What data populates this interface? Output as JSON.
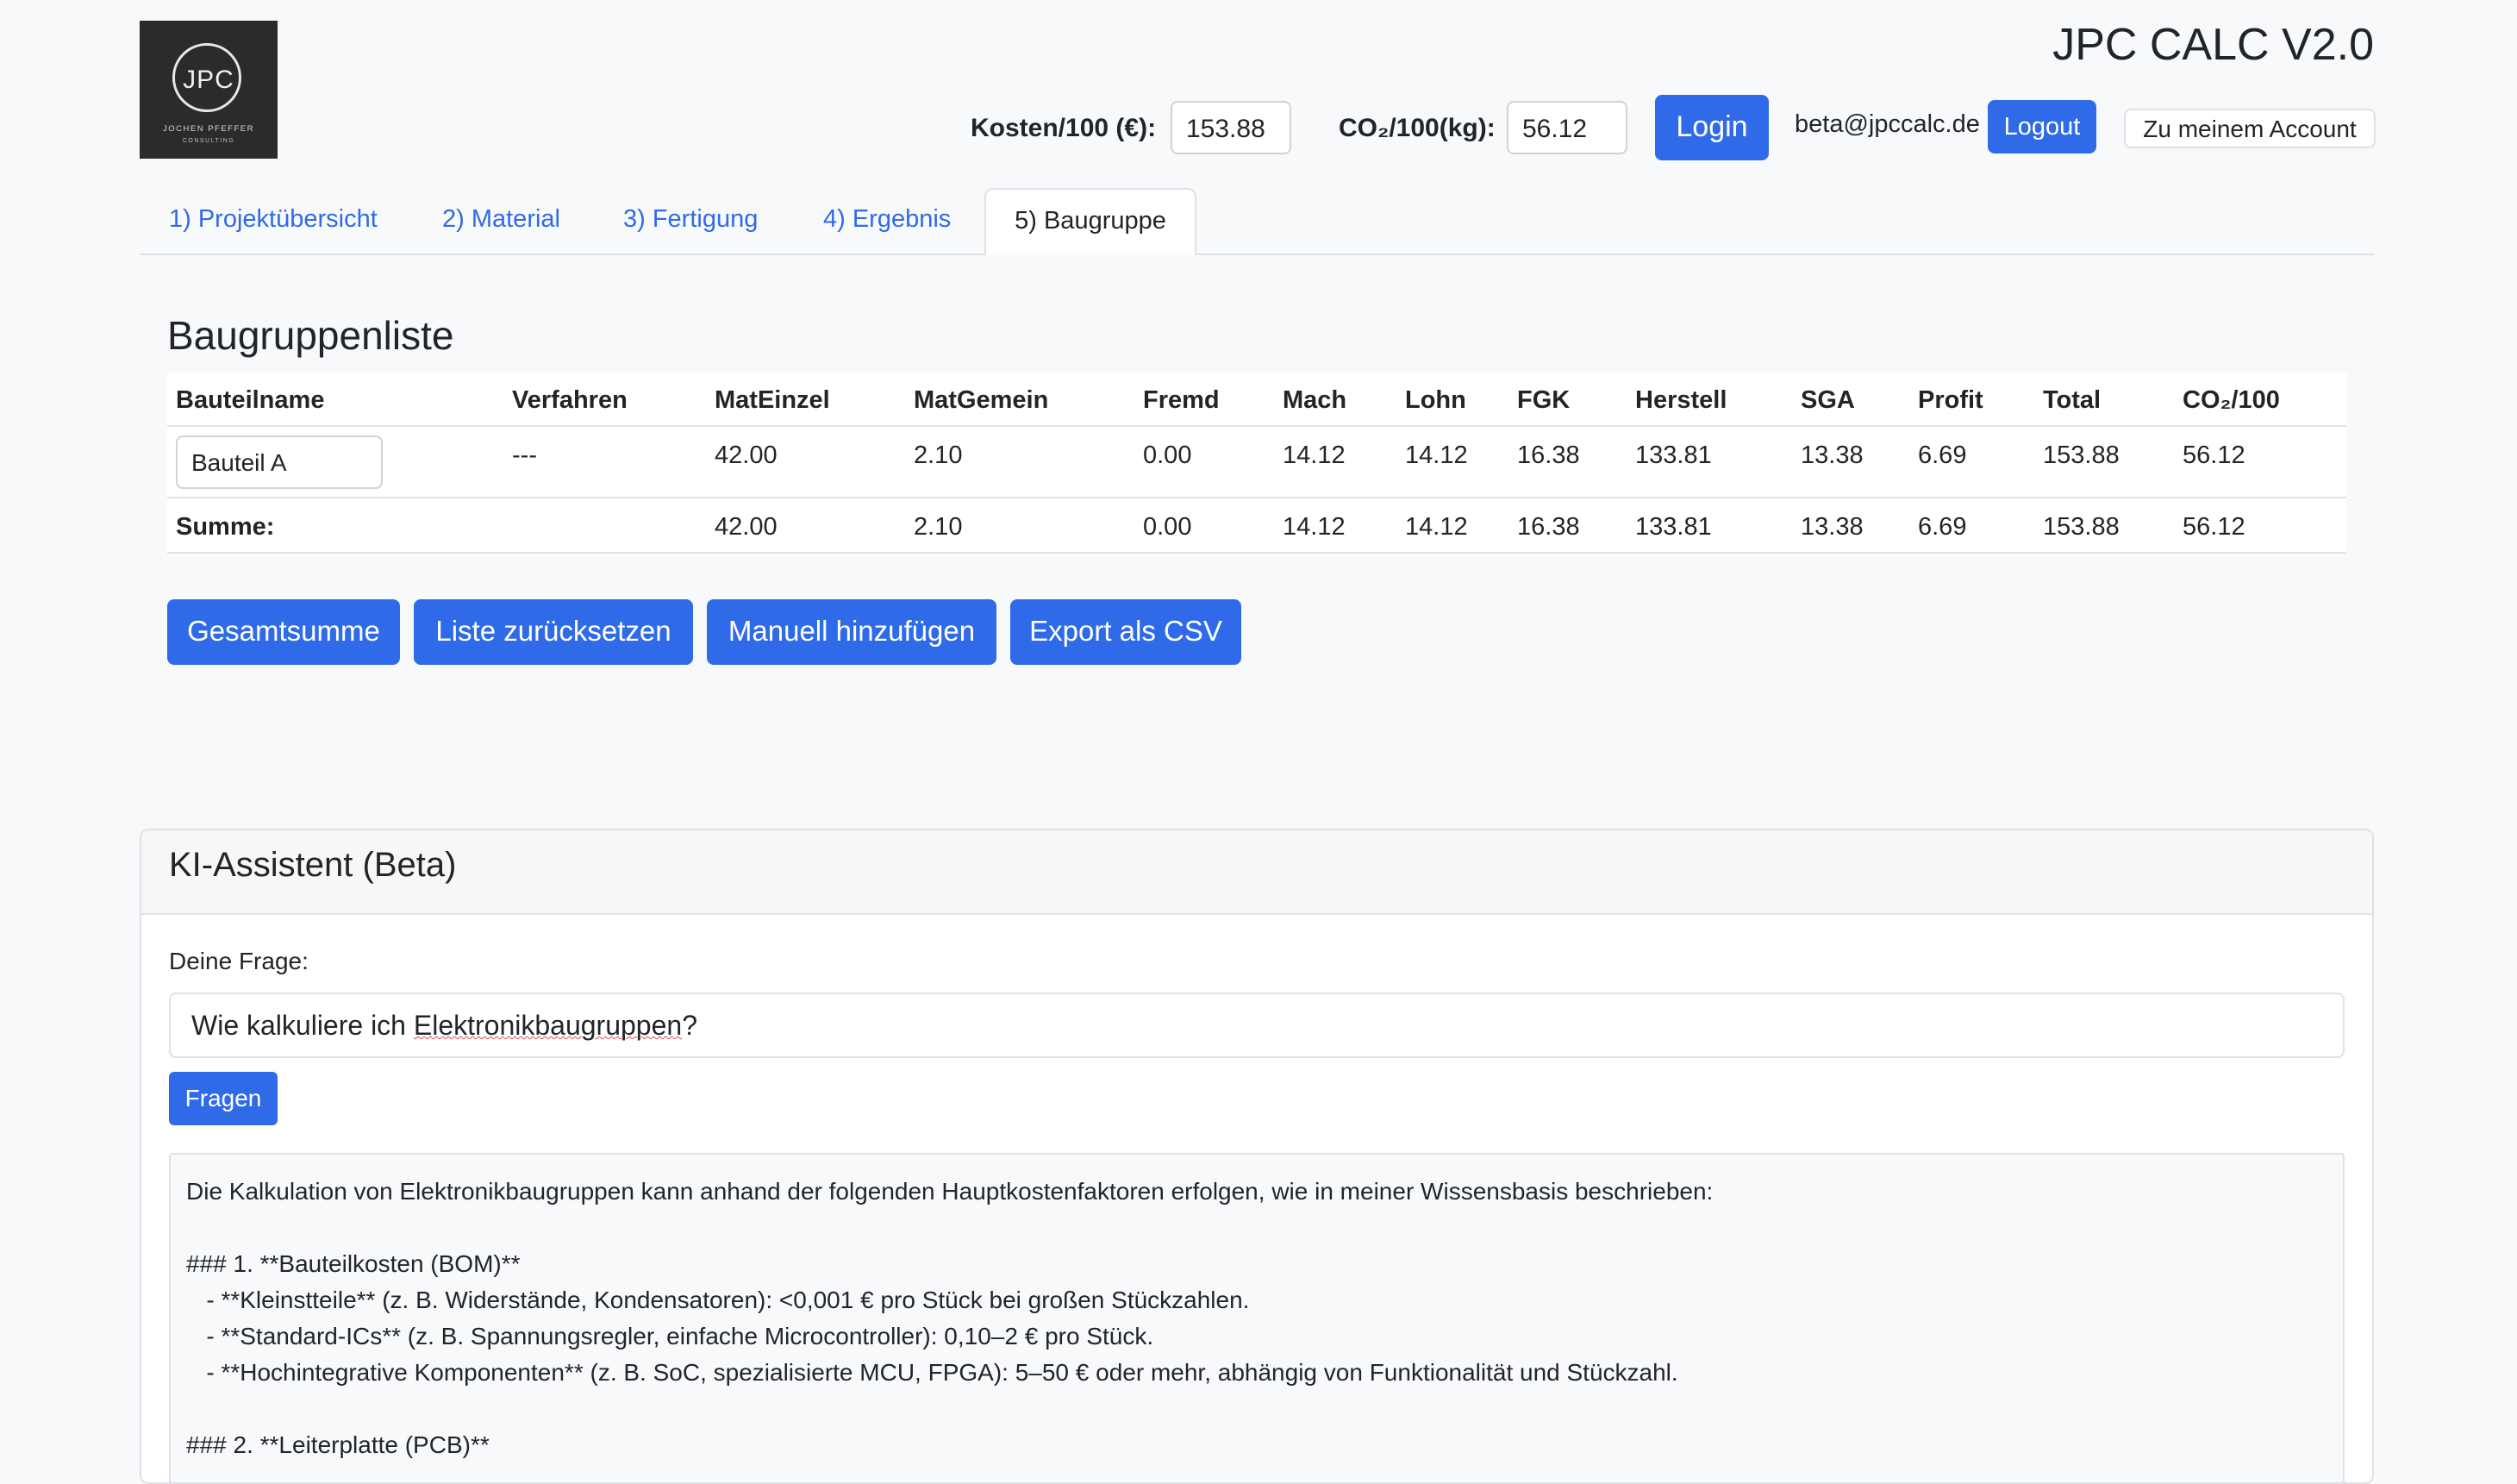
{
  "logo": {
    "mark": "JPC",
    "line1": "JOCHEN PFEFFER",
    "line2": "CONSULTING"
  },
  "header": {
    "app_title": "JPC CALC V2.0",
    "cost_label": "Kosten/100 (€):",
    "cost_value": "153.88",
    "co2_label": "CO₂/100(kg):",
    "co2_value": "56.12",
    "login_label": "Login",
    "user_email": "beta@jpccalc.de",
    "logout_label": "Logout",
    "account_label": "Zu meinem Account"
  },
  "tabs": [
    {
      "label": "1) Projektübersicht"
    },
    {
      "label": "2) Material"
    },
    {
      "label": "3) Fertigung"
    },
    {
      "label": "4) Ergebnis"
    },
    {
      "label": "5) Baugruppe",
      "active": true
    }
  ],
  "list": {
    "title": "Baugruppenliste",
    "columns": [
      "Bauteilname",
      "Verfahren",
      "MatEinzel",
      "MatGemein",
      "Fremd",
      "Mach",
      "Lohn",
      "FGK",
      "Herstell",
      "SGA",
      "Profit",
      "Total",
      "CO₂/100"
    ],
    "rows": [
      {
        "name": "Bauteil A",
        "verfahren": "---",
        "values": [
          "42.00",
          "2.10",
          "0.00",
          "14.12",
          "14.12",
          "16.38",
          "133.81",
          "13.38",
          "6.69",
          "153.88",
          "56.12"
        ]
      }
    ],
    "sum": {
      "label": "Summe:",
      "values": [
        "42.00",
        "2.10",
        "0.00",
        "14.12",
        "14.12",
        "16.38",
        "133.81",
        "13.38",
        "6.69",
        "153.88",
        "56.12"
      ]
    },
    "buttons": {
      "total": "Gesamtsumme",
      "reset": "Liste zurücksetzen",
      "add": "Manuell hinzufügen",
      "export": "Export als CSV"
    }
  },
  "assistant": {
    "title": "KI-Assistent (Beta)",
    "question_label": "Deine Frage:",
    "question_pre": "Wie kalkuliere ich ",
    "question_misspelled": "Elektronikbaugruppen",
    "question_post": "?",
    "ask_label": "Fragen",
    "answer": "Die Kalkulation von Elektronikbaugruppen kann anhand der folgenden Hauptkostenfaktoren erfolgen, wie in meiner Wissensbasis beschrieben:\n\n### 1. **Bauteilkosten (BOM)**\n   - **Kleinstteile** (z. B. Widerstände, Kondensatoren): <0,001 € pro Stück bei großen Stückzahlen.\n   - **Standard-ICs** (z. B. Spannungsregler, einfache Microcontroller): 0,10–2 € pro Stück.\n   - **Hochintegrative Komponenten** (z. B. SoC, spezialisierte MCU, FPGA): 5–50 € oder mehr, abhängig von Funktionalität und Stückzahl.\n\n### 2. **Leiterplatte (PCB)**"
  }
}
